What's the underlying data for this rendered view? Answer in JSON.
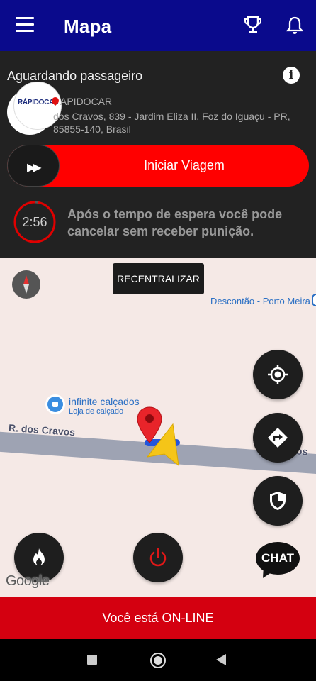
{
  "app_bar": {
    "title": "Mapa",
    "icons": [
      "menu-icon",
      "trophy-icon",
      "bell-icon"
    ]
  },
  "trip": {
    "status": "Aguardando passageiro",
    "logo_text": "RÁPIDOCAR",
    "company": "APIDOCAR",
    "address": "dos Cravos, 839 - Jardim Eliza II, Foz do Iguaçu - PR, 85855-140, Brasil",
    "start_button": "Iniciar Viagem",
    "timer": "2:56",
    "wait_message": "Após o tempo de espera você pode cancelar sem receber punição."
  },
  "map": {
    "recenter_button": "RECENTRALIZAR",
    "poi_top": "Descontão - Porto Meira",
    "store_name": "infinite calçados",
    "store_type": "Loja de calçado",
    "road_label": "R. dos Cravos",
    "road_label_right": "os",
    "chat_label": "CHAT",
    "attribution": "Google"
  },
  "online_status": "Você está ON-LINE",
  "colors": {
    "app_bar": "#0a0a8c",
    "accent_red": "#ff0000",
    "online_bar": "#d40010",
    "panel": "#222222"
  }
}
